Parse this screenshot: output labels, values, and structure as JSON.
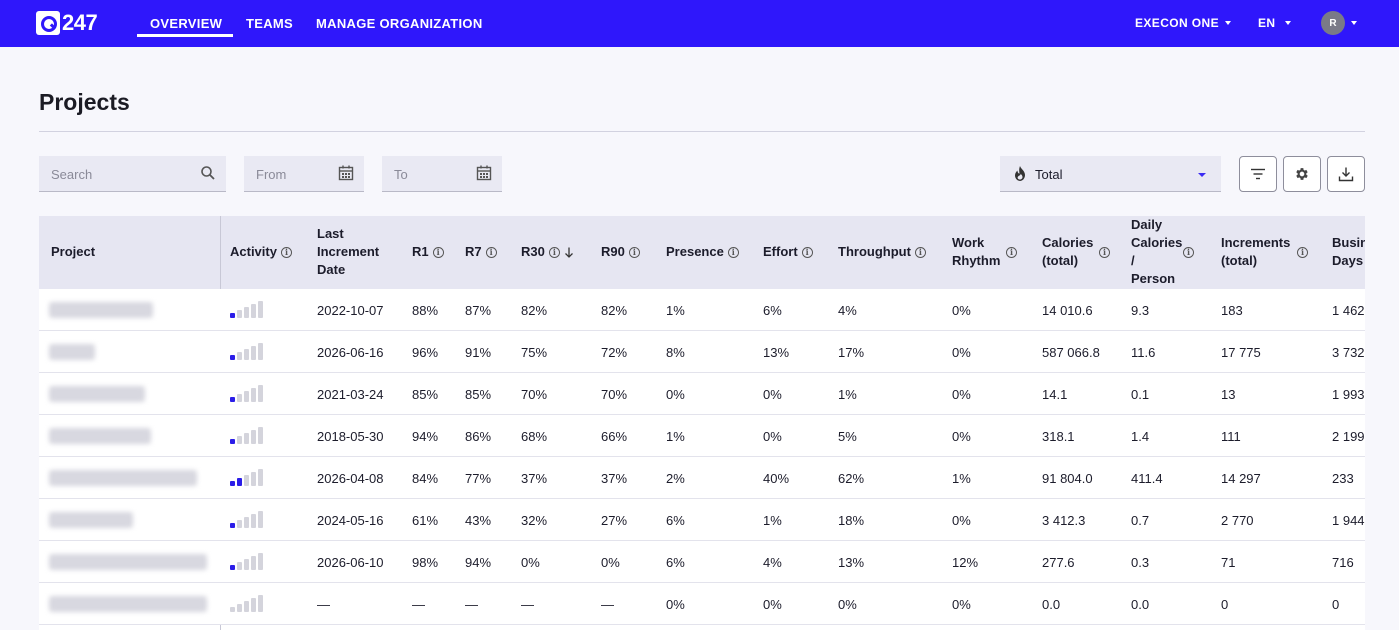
{
  "header": {
    "logo_text": "247",
    "nav": [
      "OVERVIEW",
      "TEAMS",
      "MANAGE ORGANIZATION"
    ],
    "org_selector": "EXECON ONE",
    "language": "EN",
    "avatar_initial": "R",
    "accent_color": "#2f17fb"
  },
  "page": {
    "title": "Projects"
  },
  "filters": {
    "search_placeholder": "Search",
    "from_placeholder": "From",
    "to_placeholder": "To",
    "metric_select": "Total"
  },
  "table": {
    "columns": [
      {
        "label": "Project",
        "info": false
      },
      {
        "label": "Activity",
        "info": true
      },
      {
        "label": "Last Increment Date",
        "info": false
      },
      {
        "label": "R1",
        "info": true
      },
      {
        "label": "R7",
        "info": true
      },
      {
        "label": "R30",
        "info": true,
        "sorted": "desc"
      },
      {
        "label": "R90",
        "info": true
      },
      {
        "label": "Presence",
        "info": true
      },
      {
        "label": "Effort",
        "info": true
      },
      {
        "label": "Throughput",
        "info": true
      },
      {
        "label": "Work Rhythm",
        "info": true
      },
      {
        "label": "Calories (total)",
        "info": true
      },
      {
        "label": "Daily Calories / Person",
        "info": true
      },
      {
        "label": "Increments (total)",
        "info": true
      },
      {
        "label": "Business Days",
        "info": false
      }
    ],
    "rows": [
      {
        "activity_level": 1,
        "cells": [
          "2022-10-07",
          "88%",
          "87%",
          "82%",
          "82%",
          "1%",
          "6%",
          "4%",
          "0%",
          "14 010.6",
          "9.3",
          "183",
          "1 462"
        ]
      },
      {
        "activity_level": 1,
        "cells": [
          "2026-06-16",
          "96%",
          "91%",
          "75%",
          "72%",
          "8%",
          "13%",
          "17%",
          "0%",
          "587 066.8",
          "11.6",
          "17 775",
          "3 732"
        ]
      },
      {
        "activity_level": 1,
        "cells": [
          "2021-03-24",
          "85%",
          "85%",
          "70%",
          "70%",
          "0%",
          "0%",
          "1%",
          "0%",
          "14.1",
          "0.1",
          "13",
          "1 993"
        ]
      },
      {
        "activity_level": 1,
        "cells": [
          "2018-05-30",
          "94%",
          "86%",
          "68%",
          "66%",
          "1%",
          "0%",
          "5%",
          "0%",
          "318.1",
          "1.4",
          "111",
          "2 199"
        ]
      },
      {
        "activity_level": 2,
        "cells": [
          "2026-04-08",
          "84%",
          "77%",
          "37%",
          "37%",
          "2%",
          "40%",
          "62%",
          "1%",
          "91 804.0",
          "411.4",
          "14 297",
          "233"
        ]
      },
      {
        "activity_level": 1,
        "cells": [
          "2024-05-16",
          "61%",
          "43%",
          "32%",
          "27%",
          "6%",
          "1%",
          "18%",
          "0%",
          "3 412.3",
          "0.7",
          "2 770",
          "1 944"
        ]
      },
      {
        "activity_level": 1,
        "cells": [
          "2026-06-10",
          "98%",
          "94%",
          "0%",
          "0%",
          "6%",
          "4%",
          "13%",
          "12%",
          "277.6",
          "0.3",
          "71",
          "716"
        ]
      },
      {
        "activity_level": 0,
        "cells": [
          "—",
          "—",
          "—",
          "—",
          "—",
          "0%",
          "0%",
          "0%",
          "0%",
          "0.0",
          "0.0",
          "0",
          "0"
        ]
      }
    ]
  }
}
